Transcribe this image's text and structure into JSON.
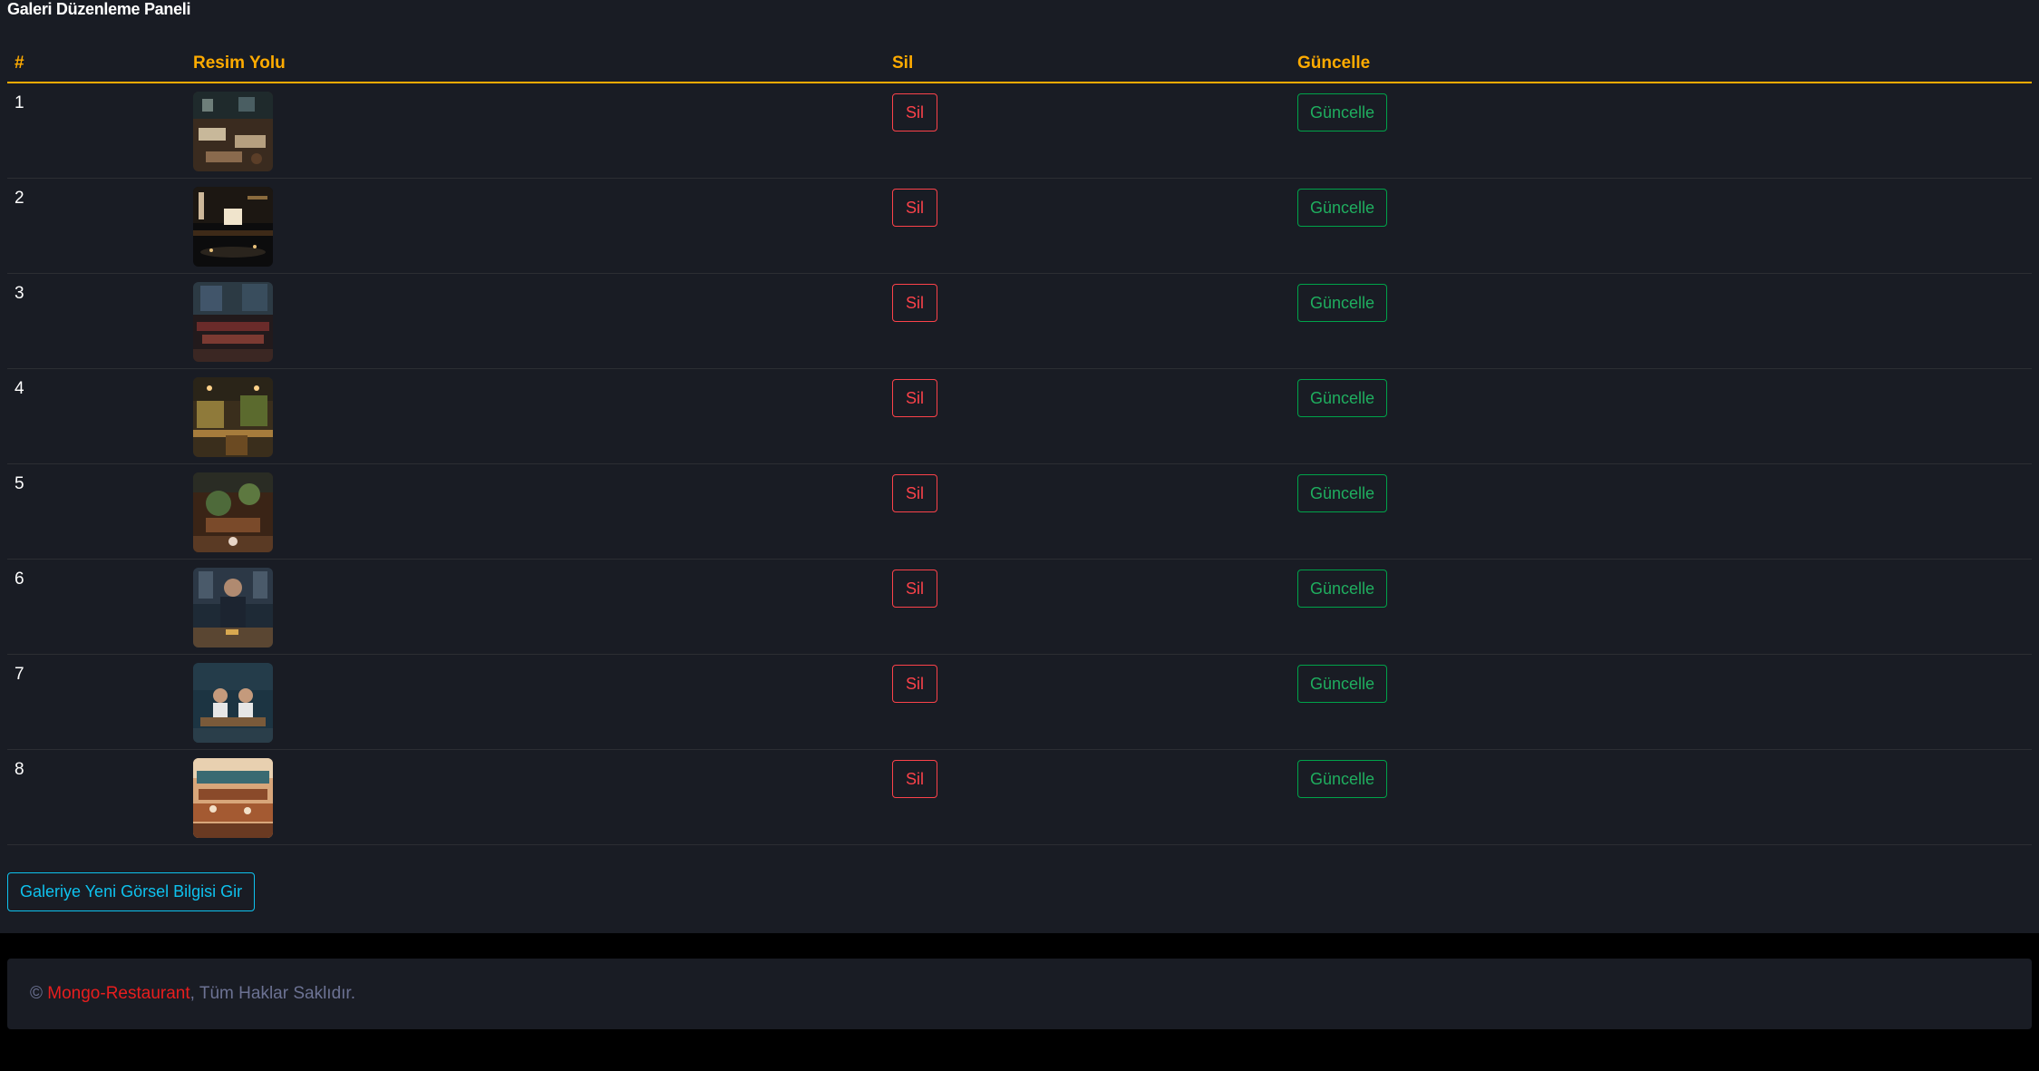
{
  "page": {
    "title": "Galeri Düzenleme Paneli"
  },
  "table": {
    "headers": {
      "num": "#",
      "image": "Resim Yolu",
      "delete": "Sil",
      "update": "Güncelle"
    },
    "rows": [
      {
        "num": "1",
        "delete_label": "Sil",
        "update_label": "Güncelle",
        "image": "restaurant-interior-photo"
      },
      {
        "num": "2",
        "delete_label": "Sil",
        "update_label": "Güncelle",
        "image": "restaurant-interior-photo"
      },
      {
        "num": "3",
        "delete_label": "Sil",
        "update_label": "Güncelle",
        "image": "restaurant-interior-photo"
      },
      {
        "num": "4",
        "delete_label": "Sil",
        "update_label": "Güncelle",
        "image": "restaurant-interior-photo"
      },
      {
        "num": "5",
        "delete_label": "Sil",
        "update_label": "Güncelle",
        "image": "restaurant-interior-photo"
      },
      {
        "num": "6",
        "delete_label": "Sil",
        "update_label": "Güncelle",
        "image": "chef-portrait-photo"
      },
      {
        "num": "7",
        "delete_label": "Sil",
        "update_label": "Güncelle",
        "image": "diners-photo"
      },
      {
        "num": "8",
        "delete_label": "Sil",
        "update_label": "Güncelle",
        "image": "outdoor-terrace-photo"
      }
    ]
  },
  "add_button": {
    "label": "Galeriye Yeni Görsel Bilgisi Gir"
  },
  "footer": {
    "copyright": "©",
    "brand": "Mongo-Restaurant",
    "rights": ", Tüm Haklar Saklıdır."
  },
  "colors": {
    "panel_bg": "#191c24",
    "page_bg": "#000000",
    "header_accent": "#ffab00",
    "danger": "#fc424a",
    "success": "#1fae5f",
    "info": "#0ec2ee",
    "brand": "#e81e1e",
    "muted": "#6c7293"
  }
}
